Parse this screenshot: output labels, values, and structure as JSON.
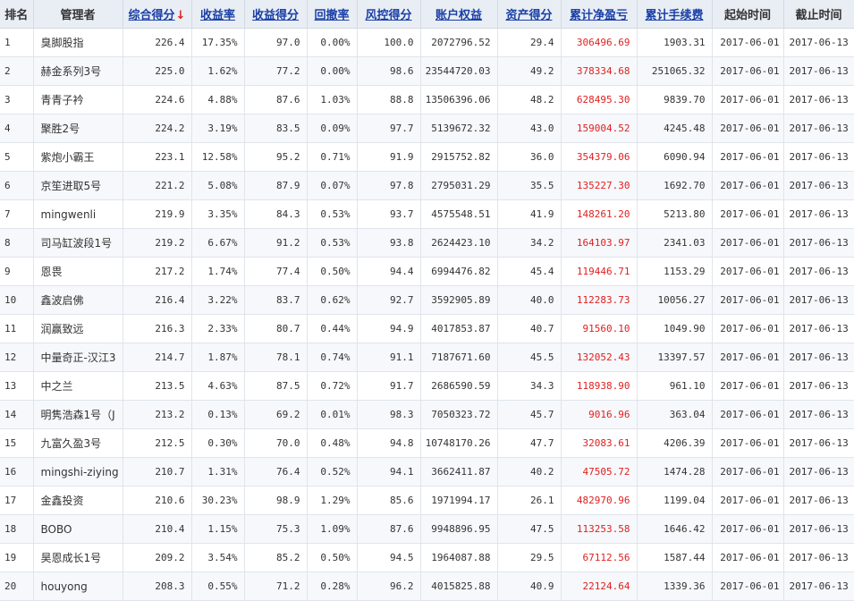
{
  "headers": {
    "rank": "排名",
    "manager": "管理者",
    "total_score": "综合得分",
    "sort_arrow": "↓",
    "return_rate": "收益率",
    "return_score": "收益得分",
    "drawdown": "回撤率",
    "risk_score": "风控得分",
    "equity": "账户权益",
    "asset_score": "资产得分",
    "net_profit": "累计净盈亏",
    "fees": "累计手续费",
    "start_date": "起始时间",
    "end_date": "截止时间"
  },
  "colors": {
    "header_bg": "#e9eef4",
    "link": "#1a3fa6",
    "profit_red": "#e02020"
  },
  "rows": [
    {
      "rank": "1",
      "name": "臭脚股指",
      "total": "226.4",
      "ret": "17.35%",
      "ret_score": "97.0",
      "dd": "0.00%",
      "risk": "100.0",
      "equity": "2072796.52",
      "asset": "29.4",
      "profit": "306496.69",
      "fee": "1903.31",
      "start": "2017-06-01",
      "end": "2017-06-13"
    },
    {
      "rank": "2",
      "name": "赫金系列3号",
      "total": "225.0",
      "ret": "1.62%",
      "ret_score": "77.2",
      "dd": "0.00%",
      "risk": "98.6",
      "equity": "23544720.03",
      "asset": "49.2",
      "profit": "378334.68",
      "fee": "251065.32",
      "start": "2017-06-01",
      "end": "2017-06-13"
    },
    {
      "rank": "3",
      "name": "青青子衿",
      "total": "224.6",
      "ret": "4.88%",
      "ret_score": "87.6",
      "dd": "1.03%",
      "risk": "88.8",
      "equity": "13506396.06",
      "asset": "48.2",
      "profit": "628495.30",
      "fee": "9839.70",
      "start": "2017-06-01",
      "end": "2017-06-13"
    },
    {
      "rank": "4",
      "name": "聚胜2号",
      "total": "224.2",
      "ret": "3.19%",
      "ret_score": "83.5",
      "dd": "0.09%",
      "risk": "97.7",
      "equity": "5139672.32",
      "asset": "43.0",
      "profit": "159004.52",
      "fee": "4245.48",
      "start": "2017-06-01",
      "end": "2017-06-13"
    },
    {
      "rank": "5",
      "name": "紫炮小霸王",
      "total": "223.1",
      "ret": "12.58%",
      "ret_score": "95.2",
      "dd": "0.71%",
      "risk": "91.9",
      "equity": "2915752.82",
      "asset": "36.0",
      "profit": "354379.06",
      "fee": "6090.94",
      "start": "2017-06-01",
      "end": "2017-06-13"
    },
    {
      "rank": "6",
      "name": "京笙进取5号",
      "total": "221.2",
      "ret": "5.08%",
      "ret_score": "87.9",
      "dd": "0.07%",
      "risk": "97.8",
      "equity": "2795031.29",
      "asset": "35.5",
      "profit": "135227.30",
      "fee": "1692.70",
      "start": "2017-06-01",
      "end": "2017-06-13"
    },
    {
      "rank": "7",
      "name": "mingwenli",
      "total": "219.9",
      "ret": "3.35%",
      "ret_score": "84.3",
      "dd": "0.53%",
      "risk": "93.7",
      "equity": "4575548.51",
      "asset": "41.9",
      "profit": "148261.20",
      "fee": "5213.80",
      "start": "2017-06-01",
      "end": "2017-06-13"
    },
    {
      "rank": "8",
      "name": "司马缸波段1号",
      "total": "219.2",
      "ret": "6.67%",
      "ret_score": "91.2",
      "dd": "0.53%",
      "risk": "93.8",
      "equity": "2624423.10",
      "asset": "34.2",
      "profit": "164103.97",
      "fee": "2341.03",
      "start": "2017-06-01",
      "end": "2017-06-13"
    },
    {
      "rank": "9",
      "name": "恩畏",
      "total": "217.2",
      "ret": "1.74%",
      "ret_score": "77.4",
      "dd": "0.50%",
      "risk": "94.4",
      "equity": "6994476.82",
      "asset": "45.4",
      "profit": "119446.71",
      "fee": "1153.29",
      "start": "2017-06-01",
      "end": "2017-06-13"
    },
    {
      "rank": "10",
      "name": "鑫波启佛",
      "total": "216.4",
      "ret": "3.22%",
      "ret_score": "83.7",
      "dd": "0.62%",
      "risk": "92.7",
      "equity": "3592905.89",
      "asset": "40.0",
      "profit": "112283.73",
      "fee": "10056.27",
      "start": "2017-06-01",
      "end": "2017-06-13"
    },
    {
      "rank": "11",
      "name": "润赢致远",
      "total": "216.3",
      "ret": "2.33%",
      "ret_score": "80.7",
      "dd": "0.44%",
      "risk": "94.9",
      "equity": "4017853.87",
      "asset": "40.7",
      "profit": "91560.10",
      "fee": "1049.90",
      "start": "2017-06-01",
      "end": "2017-06-13"
    },
    {
      "rank": "12",
      "name": "中量奇正-汉江3",
      "total": "214.7",
      "ret": "1.87%",
      "ret_score": "78.1",
      "dd": "0.74%",
      "risk": "91.1",
      "equity": "7187671.60",
      "asset": "45.5",
      "profit": "132052.43",
      "fee": "13397.57",
      "start": "2017-06-01",
      "end": "2017-06-13"
    },
    {
      "rank": "13",
      "name": "中之兰",
      "total": "213.5",
      "ret": "4.63%",
      "ret_score": "87.5",
      "dd": "0.72%",
      "risk": "91.7",
      "equity": "2686590.59",
      "asset": "34.3",
      "profit": "118938.90",
      "fee": "961.10",
      "start": "2017-06-01",
      "end": "2017-06-13"
    },
    {
      "rank": "14",
      "name": "明隽浩森1号（J",
      "total": "213.2",
      "ret": "0.13%",
      "ret_score": "69.2",
      "dd": "0.01%",
      "risk": "98.3",
      "equity": "7050323.72",
      "asset": "45.7",
      "profit": "9016.96",
      "fee": "363.04",
      "start": "2017-06-01",
      "end": "2017-06-13"
    },
    {
      "rank": "15",
      "name": "九富久盈3号",
      "total": "212.5",
      "ret": "0.30%",
      "ret_score": "70.0",
      "dd": "0.48%",
      "risk": "94.8",
      "equity": "10748170.26",
      "asset": "47.7",
      "profit": "32083.61",
      "fee": "4206.39",
      "start": "2017-06-01",
      "end": "2017-06-13"
    },
    {
      "rank": "16",
      "name": "mingshi-ziying",
      "total": "210.7",
      "ret": "1.31%",
      "ret_score": "76.4",
      "dd": "0.52%",
      "risk": "94.1",
      "equity": "3662411.87",
      "asset": "40.2",
      "profit": "47505.72",
      "fee": "1474.28",
      "start": "2017-06-01",
      "end": "2017-06-13"
    },
    {
      "rank": "17",
      "name": "金鑫投资",
      "total": "210.6",
      "ret": "30.23%",
      "ret_score": "98.9",
      "dd": "1.29%",
      "risk": "85.6",
      "equity": "1971994.17",
      "asset": "26.1",
      "profit": "482970.96",
      "fee": "1199.04",
      "start": "2017-06-01",
      "end": "2017-06-13"
    },
    {
      "rank": "18",
      "name": "BOBO",
      "total": "210.4",
      "ret": "1.15%",
      "ret_score": "75.3",
      "dd": "1.09%",
      "risk": "87.6",
      "equity": "9948896.95",
      "asset": "47.5",
      "profit": "113253.58",
      "fee": "1646.42",
      "start": "2017-06-01",
      "end": "2017-06-13"
    },
    {
      "rank": "19",
      "name": "昊恩成长1号",
      "total": "209.2",
      "ret": "3.54%",
      "ret_score": "85.2",
      "dd": "0.50%",
      "risk": "94.5",
      "equity": "1964087.88",
      "asset": "29.5",
      "profit": "67112.56",
      "fee": "1587.44",
      "start": "2017-06-01",
      "end": "2017-06-13"
    },
    {
      "rank": "20",
      "name": "houyong",
      "total": "208.3",
      "ret": "0.55%",
      "ret_score": "71.2",
      "dd": "0.28%",
      "risk": "96.2",
      "equity": "4015825.88",
      "asset": "40.9",
      "profit": "22124.64",
      "fee": "1339.36",
      "start": "2017-06-01",
      "end": "2017-06-13"
    }
  ]
}
